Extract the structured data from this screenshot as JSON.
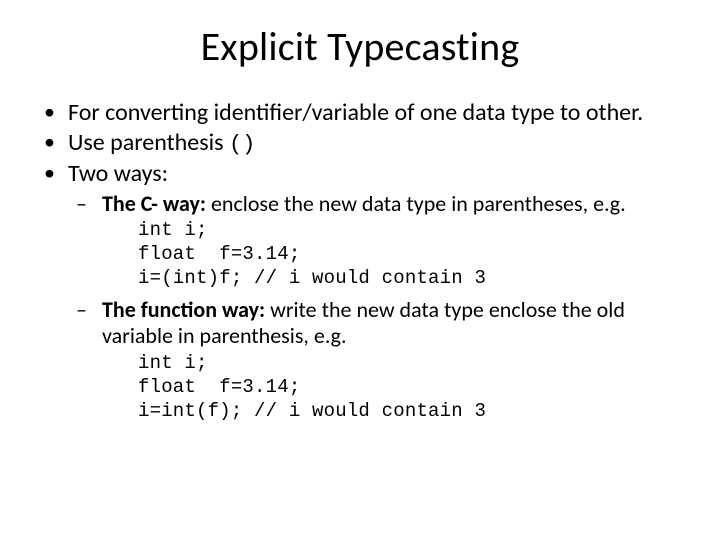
{
  "title": "Explicit Typecasting",
  "bullets": {
    "b1": "For converting identifier/variable of one data type to other.",
    "b2_pre": "Use parenthesis ",
    "b2_code": "()",
    "b3": "Two ways:"
  },
  "sub": {
    "s1_bold": "The C- way:",
    "s1_rest": " enclose the new data type in parentheses, e.g.",
    "s2_bold": "The function way:",
    "s2_rest": " write the new data type enclose the old variable in parenthesis, e.g."
  },
  "code1": {
    "l1": "int i;",
    "l2": "float  f=3.14;",
    "l3": "i=(int)f; // i would contain 3"
  },
  "code2": {
    "l1": "int i;",
    "l2": "float  f=3.14;",
    "l3": "i=int(f); // i would contain 3"
  }
}
